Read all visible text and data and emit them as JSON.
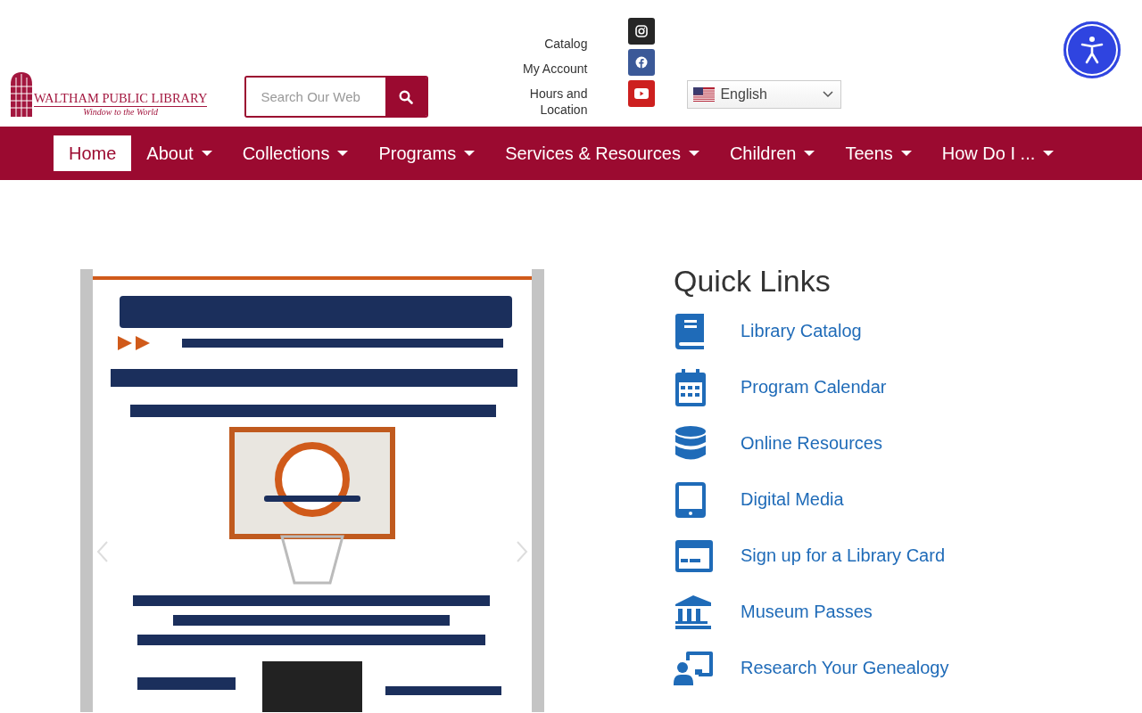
{
  "logo": {
    "name": "WALTHAM PUBLIC LIBRARY",
    "tagline": "Window to the World"
  },
  "search": {
    "placeholder": "Search Our Web"
  },
  "top_links": [
    "Catalog",
    "My Account",
    "Hours and Location"
  ],
  "social": [
    {
      "kind": "instagram"
    },
    {
      "kind": "facebook"
    },
    {
      "kind": "youtube"
    }
  ],
  "language": {
    "value": "English"
  },
  "nav": [
    {
      "label": "Home",
      "selected": true,
      "dropdown": false
    },
    {
      "label": "About",
      "selected": false,
      "dropdown": true
    },
    {
      "label": "Collections",
      "selected": false,
      "dropdown": true
    },
    {
      "label": "Programs",
      "selected": false,
      "dropdown": true
    },
    {
      "label": "Services & Resources",
      "selected": false,
      "dropdown": true
    },
    {
      "label": "Children",
      "selected": false,
      "dropdown": true
    },
    {
      "label": "Teens",
      "selected": false,
      "dropdown": true
    },
    {
      "label": "How Do I ...",
      "selected": false,
      "dropdown": true
    }
  ],
  "quick_links": {
    "title": "Quick Links",
    "items": [
      {
        "label": "Library Catalog",
        "kind": "book"
      },
      {
        "label": "Program Calendar",
        "kind": "calendar"
      },
      {
        "label": "Online Resources",
        "kind": "database"
      },
      {
        "label": "Digital Media",
        "kind": "tablet"
      },
      {
        "label": "Sign up for a Library Card",
        "kind": "card"
      },
      {
        "label": "Museum Passes",
        "kind": "museum"
      },
      {
        "label": "Research Your Genealogy",
        "kind": "research"
      }
    ]
  }
}
